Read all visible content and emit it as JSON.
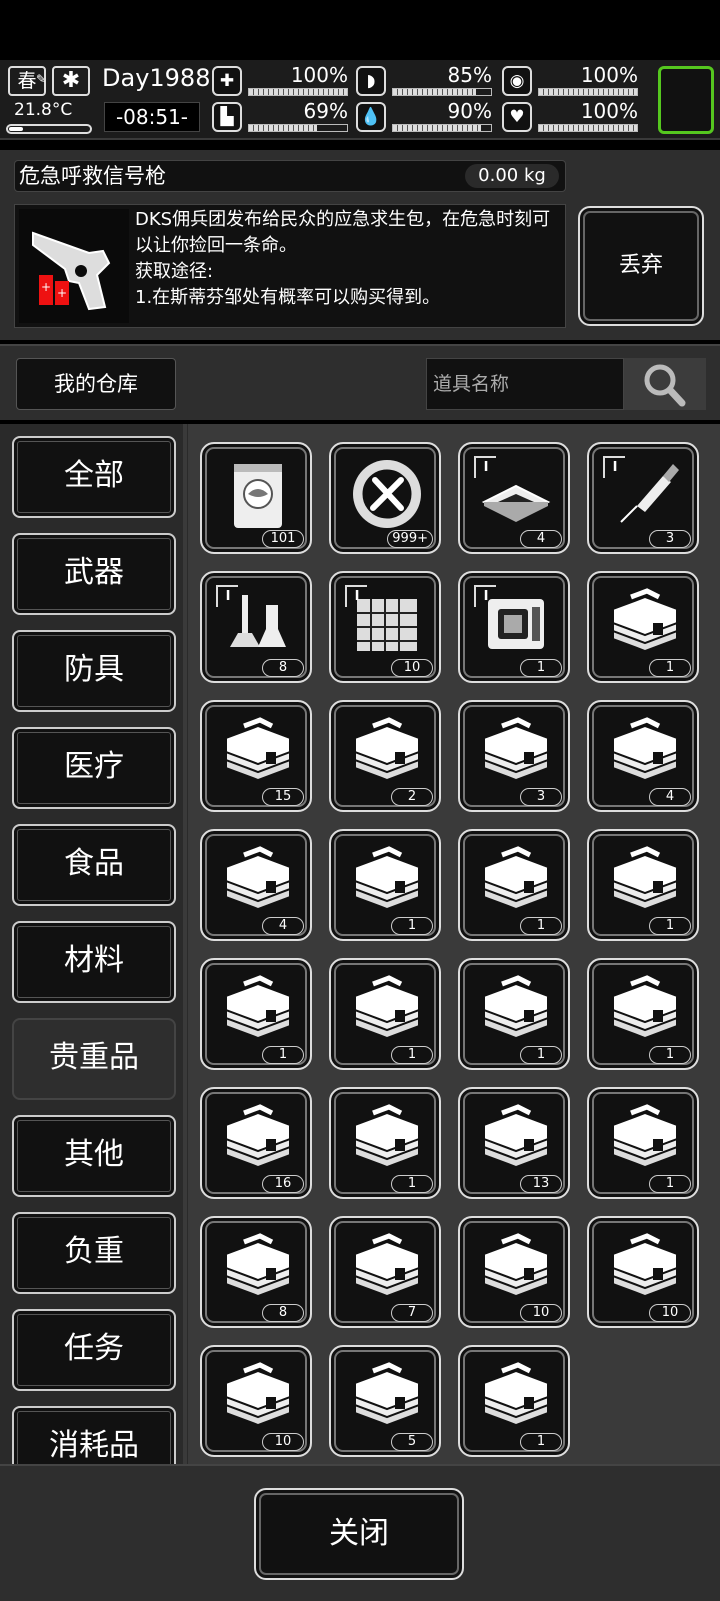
{
  "status": {
    "season": "春",
    "weather_icon": "snowflake-icon",
    "temperature": "21.8°C",
    "day": "Day1988",
    "time": "-08:51-",
    "stats": [
      {
        "icon": "health-icon",
        "glyph": "✚",
        "value": "100%",
        "level": 1.0
      },
      {
        "icon": "stomach-icon",
        "glyph": "◗",
        "value": "85%",
        "level": 0.85
      },
      {
        "icon": "lungs-icon",
        "glyph": "◉",
        "value": "100%",
        "level": 1.0
      },
      {
        "icon": "boot-icon",
        "glyph": "▙",
        "value": "69%",
        "level": 0.69
      },
      {
        "icon": "water-drop-icon",
        "glyph": "💧",
        "value": "90%",
        "level": 0.9
      },
      {
        "icon": "heart-icon",
        "glyph": "♥",
        "value": "100%",
        "level": 1.0
      }
    ]
  },
  "detail": {
    "name": "危急呼救信号枪",
    "weight": "0.00 kg",
    "description": "DKS佣兵团发布给民众的应急求生包，在危急时刻可以让你捡回一条命。\n获取途径:\n1.在斯蒂芬邹处有概率可以购买得到。",
    "discard_label": "丢弃"
  },
  "warehouse": {
    "title": "我的仓库",
    "search_placeholder": "道具名称"
  },
  "categories": [
    {
      "label": "全部",
      "active": false
    },
    {
      "label": "武器",
      "active": false
    },
    {
      "label": "防具",
      "active": false
    },
    {
      "label": "医疗",
      "active": false
    },
    {
      "label": "食品",
      "active": false
    },
    {
      "label": "材料",
      "active": false
    },
    {
      "label": "贵重品",
      "active": true
    },
    {
      "label": "其他",
      "active": false
    },
    {
      "label": "负重",
      "active": false
    },
    {
      "label": "任务",
      "active": false
    },
    {
      "label": "消耗品",
      "active": false
    }
  ],
  "items": [
    {
      "icon": "seed-bag-icon",
      "count": "101",
      "tag": ""
    },
    {
      "icon": "tool-coin-icon",
      "count": "999+",
      "tag": ""
    },
    {
      "icon": "chip-icon",
      "count": "4",
      "tag": "I"
    },
    {
      "icon": "syringe-icon",
      "count": "3",
      "tag": "I"
    },
    {
      "icon": "lab-equipment-icon",
      "count": "8",
      "tag": "I"
    },
    {
      "icon": "circuit-board-icon",
      "count": "10",
      "tag": "I"
    },
    {
      "icon": "machine-part-icon",
      "count": "1",
      "tag": "I"
    },
    {
      "icon": "supply-case-icon",
      "count": "1",
      "tag": ""
    },
    {
      "icon": "supply-case-icon",
      "count": "15",
      "tag": ""
    },
    {
      "icon": "supply-case-icon",
      "count": "2",
      "tag": ""
    },
    {
      "icon": "supply-case-icon",
      "count": "3",
      "tag": ""
    },
    {
      "icon": "supply-case-icon",
      "count": "4",
      "tag": ""
    },
    {
      "icon": "supply-case-icon",
      "count": "4",
      "tag": ""
    },
    {
      "icon": "supply-case-icon",
      "count": "1",
      "tag": ""
    },
    {
      "icon": "supply-case-icon",
      "count": "1",
      "tag": ""
    },
    {
      "icon": "supply-case-icon",
      "count": "1",
      "tag": ""
    },
    {
      "icon": "supply-case-icon",
      "count": "1",
      "tag": ""
    },
    {
      "icon": "supply-case-icon",
      "count": "1",
      "tag": ""
    },
    {
      "icon": "supply-case-icon",
      "count": "1",
      "tag": ""
    },
    {
      "icon": "supply-case-icon",
      "count": "1",
      "tag": ""
    },
    {
      "icon": "supply-case-icon",
      "count": "16",
      "tag": ""
    },
    {
      "icon": "supply-case-icon",
      "count": "1",
      "tag": ""
    },
    {
      "icon": "supply-case-icon",
      "count": "13",
      "tag": ""
    },
    {
      "icon": "supply-case-icon",
      "count": "1",
      "tag": ""
    },
    {
      "icon": "supply-case-icon",
      "count": "8",
      "tag": ""
    },
    {
      "icon": "supply-case-icon",
      "count": "7",
      "tag": ""
    },
    {
      "icon": "supply-case-icon",
      "count": "10",
      "tag": ""
    },
    {
      "icon": "supply-case-icon",
      "count": "10",
      "tag": ""
    },
    {
      "icon": "supply-case-icon",
      "count": "10",
      "tag": ""
    },
    {
      "icon": "supply-case-icon",
      "count": "5",
      "tag": ""
    },
    {
      "icon": "supply-case-icon",
      "count": "1",
      "tag": ""
    }
  ],
  "close_label": "关闭",
  "colors": {
    "accent": "#55c71f",
    "panel": "#2e2e2e",
    "slot": "#111111"
  }
}
